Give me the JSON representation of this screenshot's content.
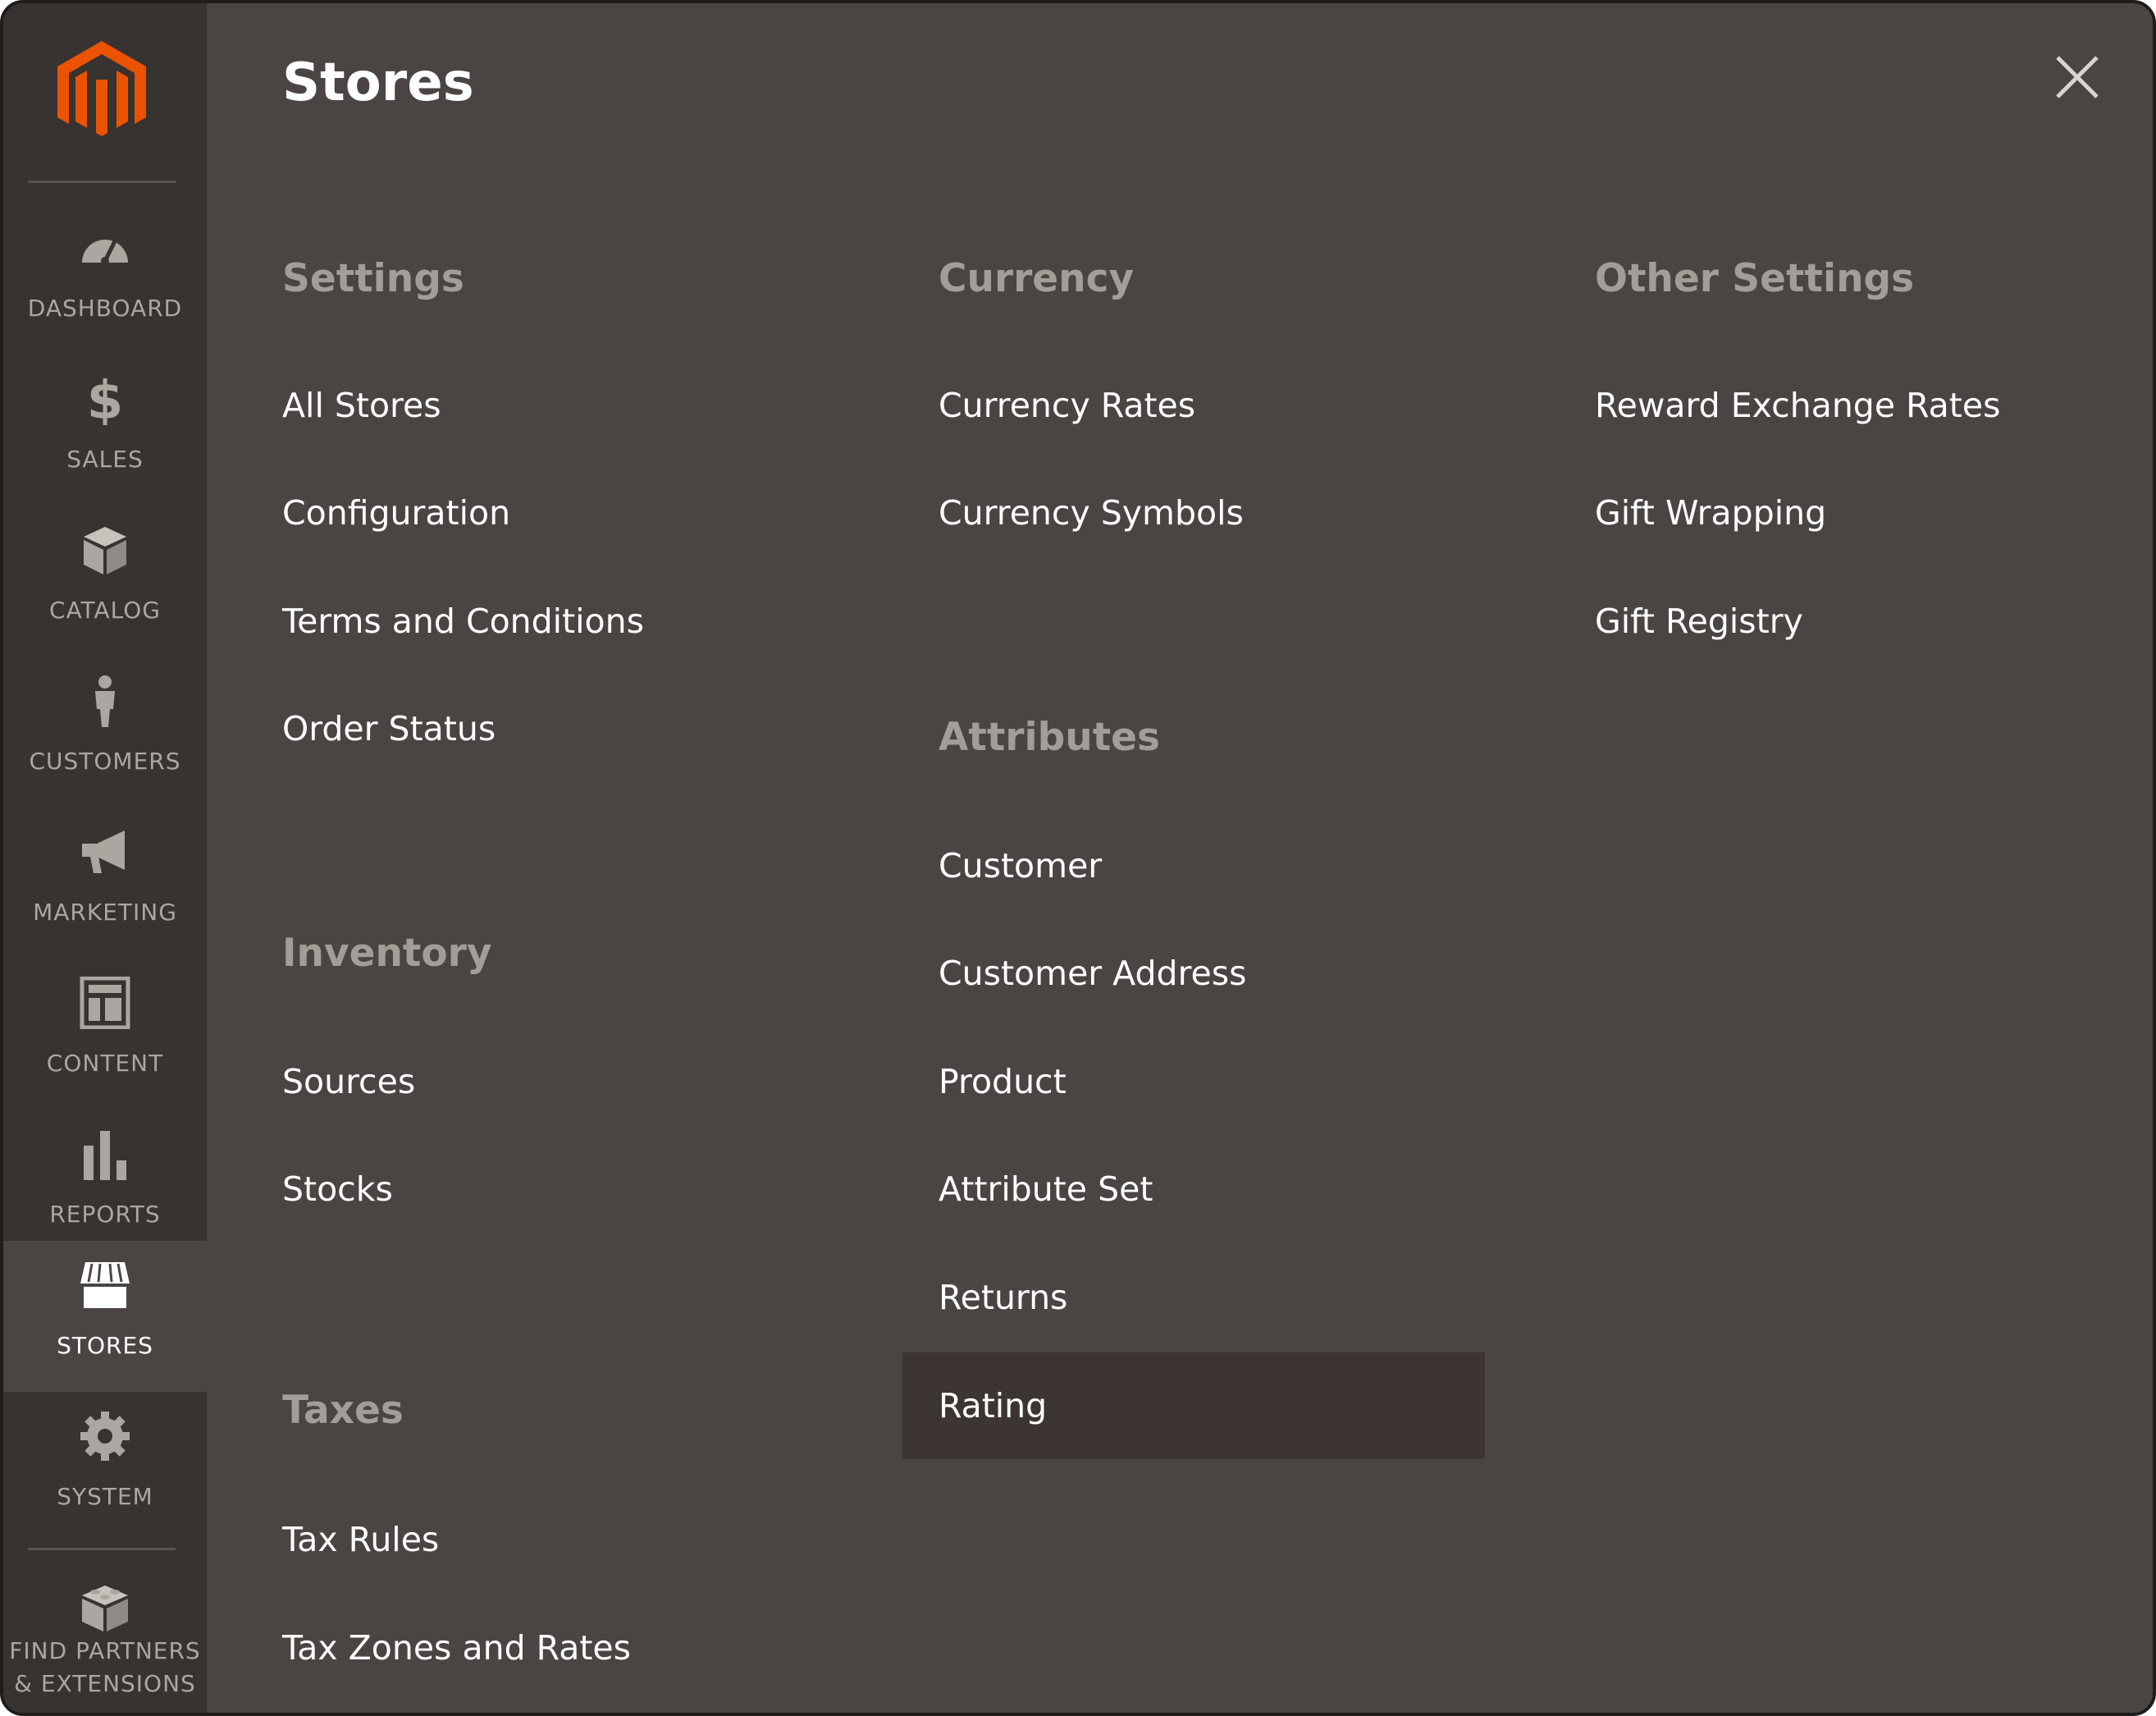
{
  "sidebar": {
    "items": [
      {
        "label": "DASHBOARD",
        "icon": "dashboard-icon"
      },
      {
        "label": "SALES",
        "icon": "dollar-icon"
      },
      {
        "label": "CATALOG",
        "icon": "box-icon"
      },
      {
        "label": "CUSTOMERS",
        "icon": "person-icon"
      },
      {
        "label": "MARKETING",
        "icon": "megaphone-icon"
      },
      {
        "label": "CONTENT",
        "icon": "layout-icon"
      },
      {
        "label": "REPORTS",
        "icon": "bar-chart-icon"
      },
      {
        "label": "STORES",
        "icon": "storefront-icon",
        "active": true
      },
      {
        "label": "SYSTEM",
        "icon": "gear-icon"
      },
      {
        "label": "FIND PARTNERS & EXTENSIONS",
        "label_line1": "FIND PARTNERS",
        "label_line2": "& EXTENSIONS",
        "icon": "blocks-icon"
      }
    ]
  },
  "panel": {
    "title": "Stores",
    "groups": {
      "settings": {
        "heading": "Settings",
        "links": [
          "All Stores",
          "Configuration",
          "Terms and Conditions",
          "Order Status"
        ]
      },
      "inventory": {
        "heading": "Inventory",
        "links": [
          "Sources",
          "Stocks"
        ]
      },
      "taxes": {
        "heading": "Taxes",
        "links": [
          "Tax Rules",
          "Tax Zones and Rates"
        ]
      },
      "currency": {
        "heading": "Currency",
        "links": [
          "Currency Rates",
          "Currency Symbols"
        ]
      },
      "attributes": {
        "heading": "Attributes",
        "links": [
          "Customer",
          "Customer Address",
          "Product",
          "Attribute Set",
          "Returns",
          "Rating"
        ],
        "highlighted": "Rating"
      },
      "other_settings": {
        "heading": "Other Settings",
        "links": [
          "Reward Exchange Rates",
          "Gift Wrapping",
          "Gift Registry"
        ]
      }
    }
  },
  "colors": {
    "panel_bg": "#4a4542",
    "sidebar_bg": "#373330",
    "brand_orange": "#eb5202",
    "heading": "#a29d97",
    "highlight_bg": "#3c3531"
  }
}
